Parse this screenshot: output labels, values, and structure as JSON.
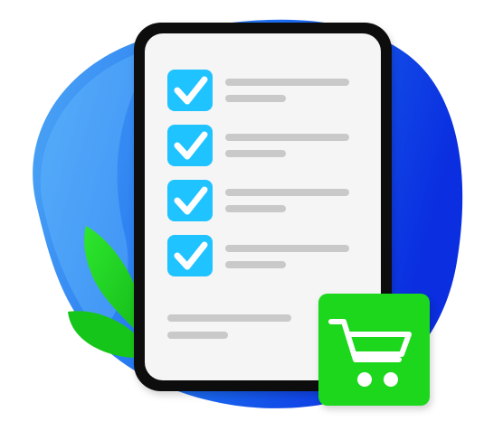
{
  "illustration": {
    "colors": {
      "blob_light": "#4fa8f5",
      "blob_dark": "#0a2ee0",
      "leaf": "#19d41c",
      "leaf_shadow": "#0fa814",
      "phone_frame": "#111111",
      "phone_screen": "#f5f5f5",
      "checkbox_fill": "#1ec3ff",
      "checkmark": "#ffffff",
      "text_line": "#c9c9c9",
      "cart_badge": "#1fd71e",
      "cart_icon": "#ffffff"
    },
    "checklist": {
      "items": [
        {
          "checked": true
        },
        {
          "checked": true
        },
        {
          "checked": true
        },
        {
          "checked": true
        }
      ]
    },
    "icons": {
      "checkbox": "checkbox-checked-icon",
      "cart": "shopping-cart-icon"
    }
  }
}
